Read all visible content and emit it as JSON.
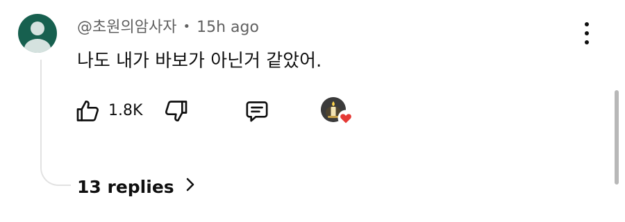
{
  "comment": {
    "author": "@초원의암사자",
    "separator": "•",
    "time": "15h ago",
    "text": "나도 내가 바보가 아닌거 같았어.",
    "like_count": "1.8K"
  },
  "replies": {
    "label": "13 replies"
  },
  "icons": {
    "avatar": "default-user-avatar",
    "more": "kebab-menu-icon",
    "like": "thumbs-up-icon",
    "dislike": "thumbs-down-icon",
    "reply": "comment-reply-icon",
    "creator_heart": "creator-heart-badge",
    "chevron": "chevron-right-icon"
  },
  "colors": {
    "avatar_bg": "#17604f",
    "heart": "#e53935",
    "meta_text": "#606060"
  }
}
